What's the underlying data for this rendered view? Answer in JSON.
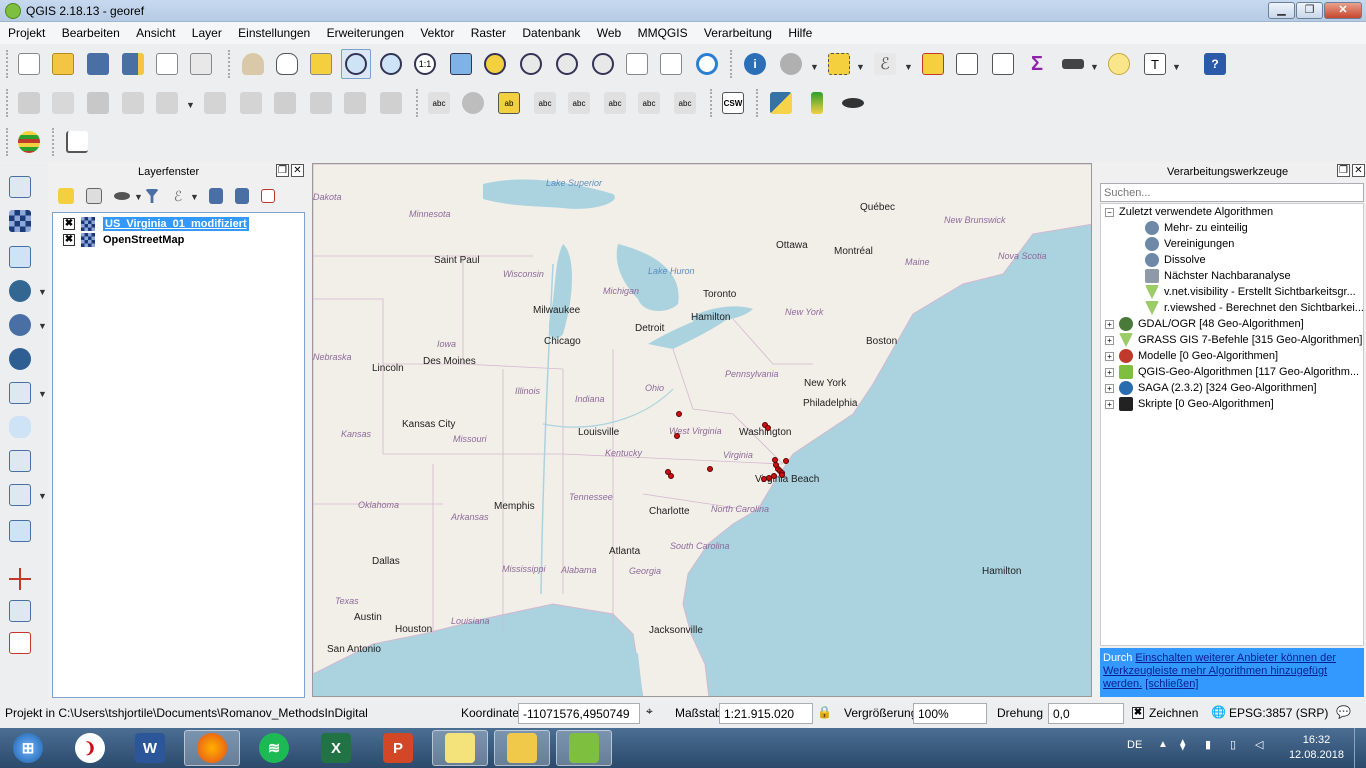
{
  "window": {
    "title": "QGIS 2.18.13 - georef"
  },
  "menu": [
    "Projekt",
    "Bearbeiten",
    "Ansicht",
    "Layer",
    "Einstellungen",
    "Erweiterungen",
    "Vektor",
    "Raster",
    "Datenbank",
    "Web",
    "MMQGIS",
    "Verarbeitung",
    "Hilfe"
  ],
  "toolbar_labels": {
    "csw": "CSW"
  },
  "layer_panel": {
    "title": "Layerfenster",
    "layers": [
      {
        "name": "US_Virginia_01_modifiziert",
        "checked": "✖",
        "selected": true
      },
      {
        "name": "OpenStreetMap",
        "checked": "✖",
        "selected": false
      }
    ]
  },
  "map": {
    "cities": [
      "Québec",
      "Ottawa",
      "Montréal",
      "Toronto",
      "Hamilton",
      "Boston",
      "New York",
      "Philadelphia",
      "Washington",
      "Virginia Beach",
      "Charlotte",
      "Atlanta",
      "Jacksonville",
      "Memphis",
      "Louisville",
      "Kansas City",
      "Des Moines",
      "Lincoln",
      "Milwaukee",
      "Chicago",
      "Detroit",
      "Saint Paul",
      "Dallas",
      "Austin",
      "Houston",
      "San Antonio",
      "Hamilton"
    ],
    "states": [
      "Minnesota",
      "Wisconsin",
      "Michigan",
      "Iowa",
      "Illinois",
      "Indiana",
      "Ohio",
      "Kentucky",
      "Tennessee",
      "Missouri",
      "Kansas",
      "Arkansas",
      "Mississippi",
      "Alabama",
      "Georgia",
      "Louisiana",
      "Texas",
      "Oklahoma",
      "Pennsylvania",
      "New York",
      "Maine",
      "West Virginia",
      "Virginia",
      "North Carolina",
      "South Carolina",
      "New Brunswick",
      "Nova Scotia",
      "Dakota",
      "Nebraska"
    ],
    "water": [
      "Lake Superior",
      "Lake Huron"
    ],
    "point_count": 17
  },
  "processing_panel": {
    "title": "Verarbeitungswerkzeuge",
    "search_placeholder": "Suchen...",
    "recent_group": "Zuletzt verwendete Algorithmen",
    "recent": [
      "Mehr- zu einteilig",
      "Vereinigungen",
      "Dissolve",
      "Nächster Nachbaranalyse",
      "v.net.visibility - Erstellt Sichtbarkeitsgr...",
      "r.viewshed - Berechnet den Sichtbarkei..."
    ],
    "providers": [
      "GDAL/OGR [48 Geo-Algorithmen]",
      "GRASS GIS 7-Befehle [315 Geo-Algorithmen]",
      "Modelle [0 Geo-Algorithmen]",
      "QGIS-Geo-Algorithmen [117 Geo-Algorithm...",
      "SAGA (2.3.2) [324 Geo-Algorithmen]",
      "Skripte [0 Geo-Algorithmen]"
    ],
    "info_prefix": "Durch",
    "info_link": "Einschalten weiterer Anbieter können der Werkzeugleiste mehr Algorithmen hinzugefügt werden.",
    "info_close": "[schließen]"
  },
  "statusbar": {
    "project_path": "Projekt in C:\\Users\\tshjortile\\Documents\\Romanov_MethodsInDigital",
    "coord_label": "Koordinate",
    "coord_value": "-11071576,4950749",
    "scale_label": "Maßstab",
    "scale_value": "1:21.915.020",
    "zoom_label": "Vergrößerung",
    "zoom_value": "100%",
    "rotation_label": "Drehung",
    "rotation_value": "0,0",
    "render_label": "Zeichnen",
    "crs": "EPSG:3857 (SRP)"
  },
  "taskbar": {
    "lang": "DE",
    "time": "16:32",
    "date": "12.08.2018"
  }
}
